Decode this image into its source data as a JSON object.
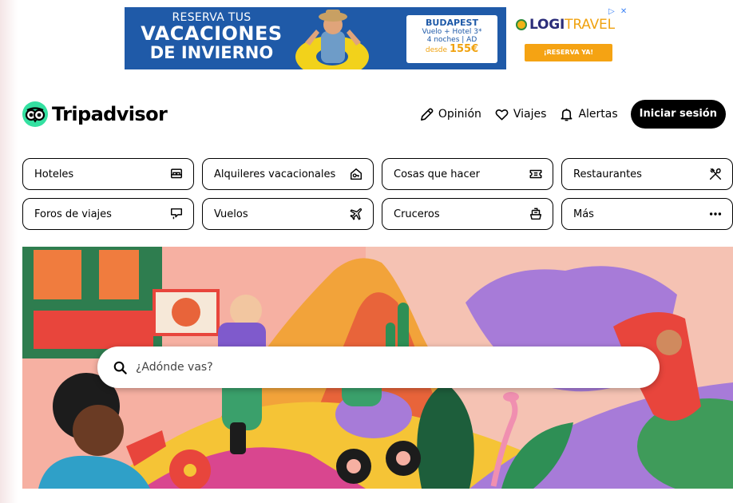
{
  "ad": {
    "headline_line1": "RESERVA TUS",
    "headline_line2": "VACACIONES",
    "headline_line3": "DE INVIERNO",
    "offer_city": "BUDAPEST",
    "offer_line1": "Vuelo + Hotel 3*",
    "offer_line2": "4 noches | AD",
    "offer_from": "desde",
    "offer_price": "155€",
    "brand_main": "LOGI",
    "brand_accent": "TRAVEL",
    "cta": "¡RESERVA YA!",
    "colors": {
      "bg": "#1f5aa8",
      "accent": "#f5a313"
    }
  },
  "header": {
    "logo_text": "Tripadvisor",
    "nav": [
      {
        "label": "Opinión",
        "icon": "pencil-icon"
      },
      {
        "label": "Viajes",
        "icon": "heart-icon"
      },
      {
        "label": "Alertas",
        "icon": "bell-icon"
      }
    ],
    "signin": "Iniciar sesión"
  },
  "categories": [
    {
      "label": "Hoteles",
      "icon": "bed-icon"
    },
    {
      "label": "Alquileres vacacionales",
      "icon": "house-key-icon"
    },
    {
      "label": "Cosas que hacer",
      "icon": "ticket-icon"
    },
    {
      "label": "Restaurantes",
      "icon": "cutlery-icon"
    },
    {
      "label": "Foros de viajes",
      "icon": "forum-icon"
    },
    {
      "label": "Vuelos",
      "icon": "plane-icon"
    },
    {
      "label": "Cruceros",
      "icon": "ship-icon"
    },
    {
      "label": "Más",
      "icon": "more-icon"
    }
  ],
  "search": {
    "placeholder": "¿Adónde vas?"
  }
}
